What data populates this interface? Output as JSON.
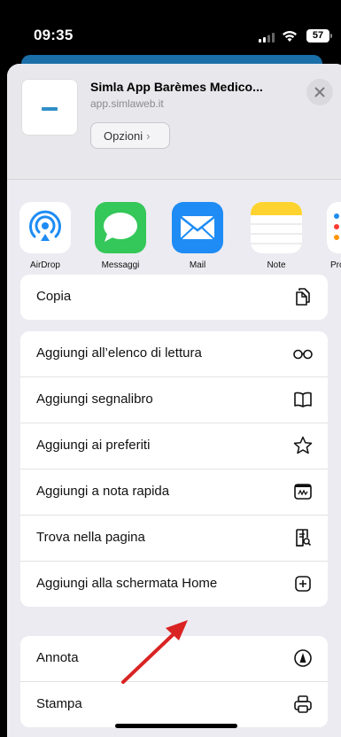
{
  "status": {
    "time": "09:35",
    "battery": "57"
  },
  "share_header": {
    "title": "Simla App Barèmes Medico...",
    "url": "app.simlaweb.it",
    "options_label": "Opzioni"
  },
  "apps": [
    {
      "label": "AirDrop",
      "icon": "airdrop-icon"
    },
    {
      "label": "Messaggi",
      "icon": "messages-icon"
    },
    {
      "label": "Mail",
      "icon": "mail-icon"
    },
    {
      "label": "Note",
      "icon": "notes-icon"
    },
    {
      "label": "Pro",
      "icon": "reminders-icon"
    }
  ],
  "actions_group1": [
    {
      "label": "Copia",
      "icon": "copy-icon"
    }
  ],
  "actions_group2": [
    {
      "label": "Aggiungi all’elenco di lettura",
      "icon": "reading-list-icon"
    },
    {
      "label": "Aggiungi segnalibro",
      "icon": "book-icon"
    },
    {
      "label": "Aggiungi ai preferiti",
      "icon": "star-icon"
    },
    {
      "label": "Aggiungi a nota rapida",
      "icon": "quick-note-icon"
    },
    {
      "label": "Trova nella pagina",
      "icon": "find-in-page-icon"
    },
    {
      "label": "Aggiungi alla schermata Home",
      "icon": "add-square-icon"
    }
  ],
  "actions_group3": [
    {
      "label": "Annota",
      "icon": "markup-icon"
    },
    {
      "label": "Stampa",
      "icon": "print-icon"
    }
  ],
  "colors": {
    "annotation_arrow": "#d92323",
    "sheet_bg": "#ecebf1"
  }
}
